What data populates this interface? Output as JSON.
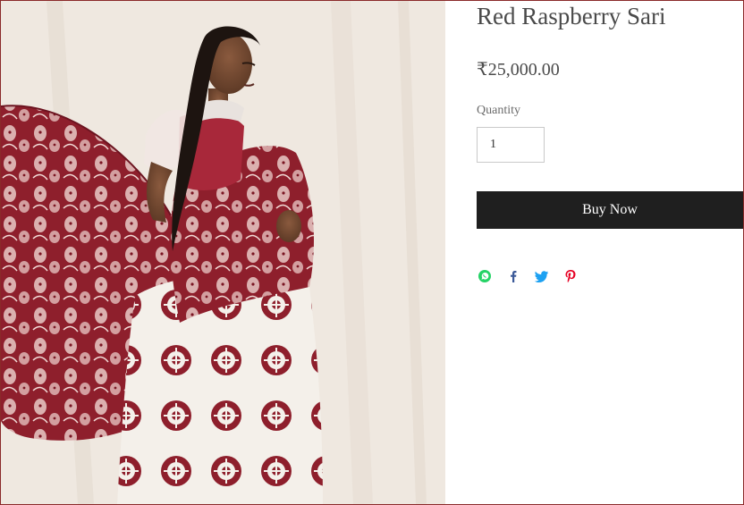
{
  "product": {
    "title": "Red Raspberry Sari",
    "price": "₹25,000.00",
    "image_alt": "Model wearing red and white printed sari"
  },
  "quantity": {
    "label": "Quantity",
    "value": "1"
  },
  "actions": {
    "buy_now_label": "Buy Now"
  },
  "share": {
    "icons": [
      "whatsapp-icon",
      "facebook-icon",
      "twitter-icon",
      "pinterest-icon"
    ]
  },
  "colors": {
    "sari_red": "#8e1f2c",
    "blouse_red": "#a8283a",
    "button_bg": "#1f1f1f",
    "whatsapp": "#25d366",
    "facebook": "#3b5998",
    "twitter": "#1da1f2",
    "pinterest": "#e60023",
    "frame_border": "#8a2a2a"
  }
}
